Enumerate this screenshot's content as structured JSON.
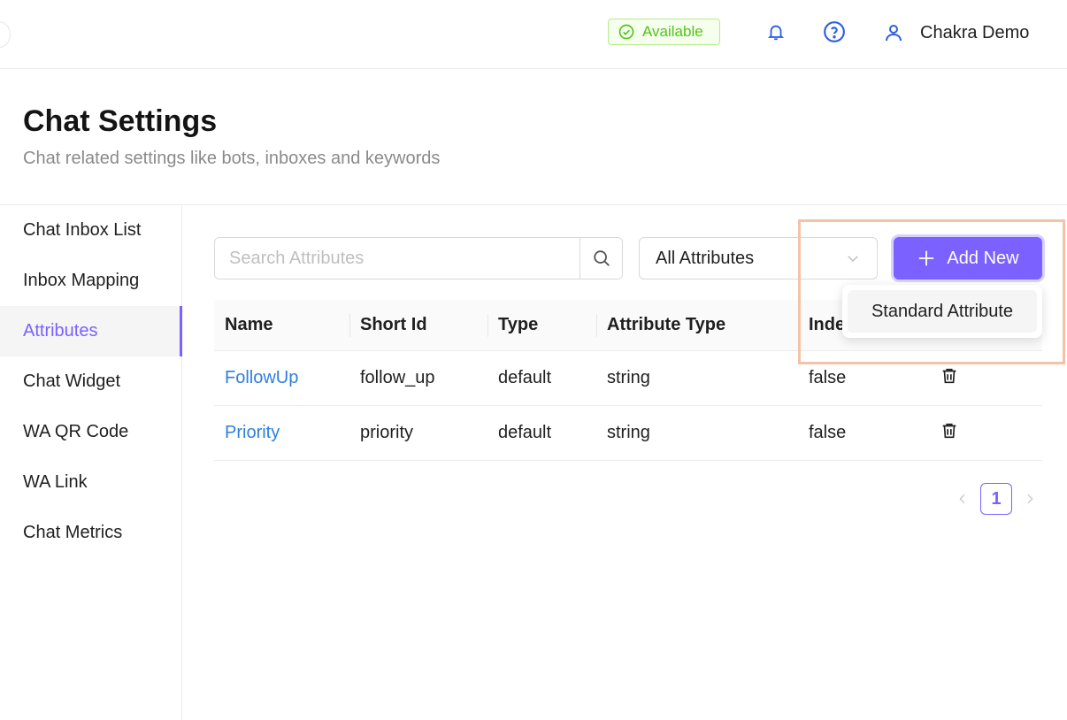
{
  "header": {
    "status": "Available",
    "user_name": "Chakra Demo"
  },
  "page": {
    "title": "Chat Settings",
    "subtitle": "Chat related settings like bots, inboxes and keywords"
  },
  "sidebar": {
    "items": [
      {
        "label": "Chat Inbox List"
      },
      {
        "label": "Inbox Mapping"
      },
      {
        "label": "Attributes"
      },
      {
        "label": "Chat Widget"
      },
      {
        "label": "WA QR Code"
      },
      {
        "label": "WA Link"
      },
      {
        "label": "Chat Metrics"
      }
    ],
    "active_index": 2
  },
  "toolbar": {
    "search_placeholder": "Search Attributes",
    "filter_value": "All Attributes",
    "add_label": "Add New"
  },
  "dropdown": {
    "items": [
      {
        "label": "Standard Attribute"
      }
    ]
  },
  "table": {
    "columns": [
      "Name",
      "Short Id",
      "Type",
      "Attribute Type",
      "Inde"
    ],
    "rows": [
      {
        "name": "FollowUp",
        "short_id": "follow_up",
        "type": "default",
        "attribute_type": "string",
        "indexed": "false"
      },
      {
        "name": "Priority",
        "short_id": "priority",
        "type": "default",
        "attribute_type": "string",
        "indexed": "false"
      }
    ]
  },
  "pagination": {
    "current": "1"
  },
  "colors": {
    "accent": "#7b61ff",
    "link": "#2f7fdc",
    "status_green": "#52c41a",
    "highlight_border": "#f2c3a8"
  }
}
